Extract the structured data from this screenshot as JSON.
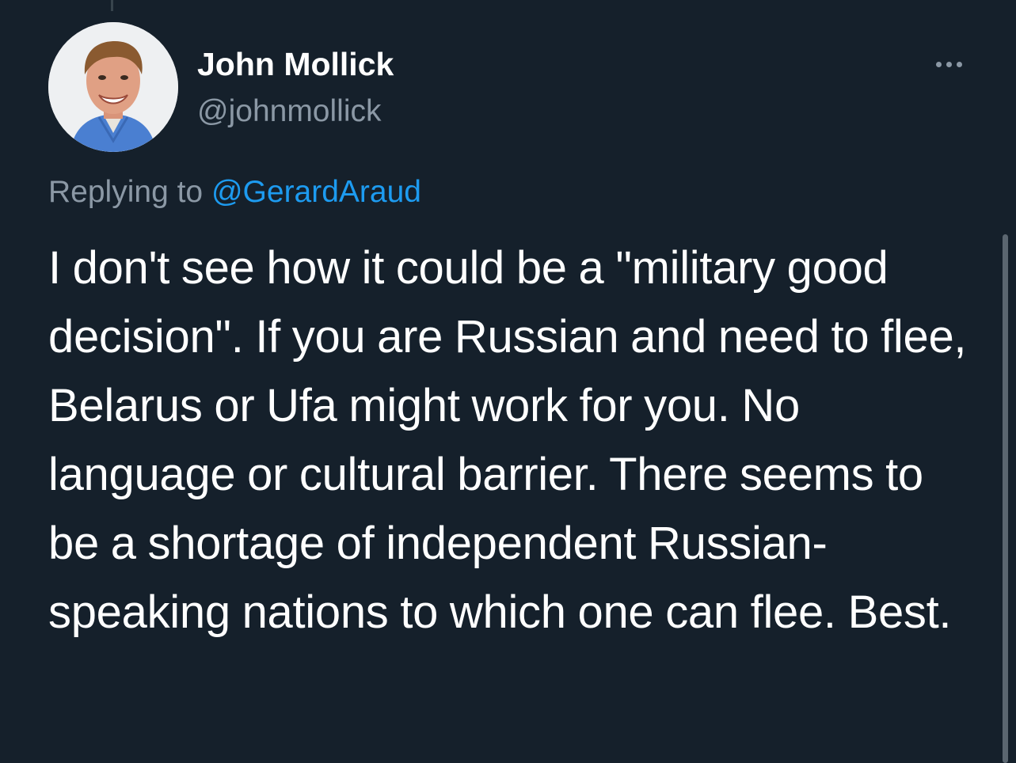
{
  "author": {
    "name": "John Mollick",
    "handle": "@johnmollick",
    "avatar": "profile-photo"
  },
  "more_menu": {
    "icon": "more-horizontal-icon"
  },
  "reply": {
    "prefix": "Replying to ",
    "target": "@GerardAraud"
  },
  "tweet": {
    "text": "I don't see how it could be a \"military good decision\". If you are Russian and need to flee, Belarus or Ufa might work for you. No language or cultural barrier. There seems to be a shortage of independent Russian-speaking nations to which one can flee. Best."
  },
  "colors": {
    "background": "#15202b",
    "primary_text": "#ffffff",
    "secondary_text": "#8b98a5",
    "link": "#1d9bf0"
  }
}
